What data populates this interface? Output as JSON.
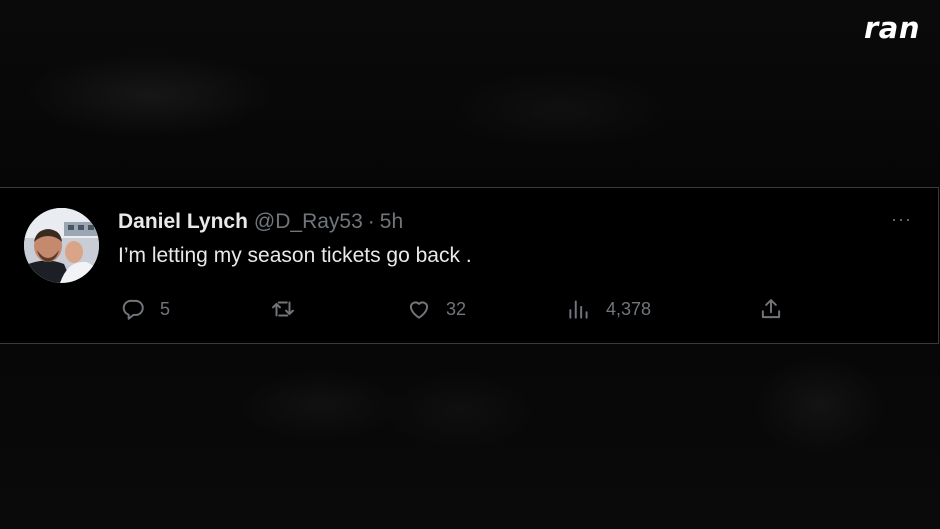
{
  "brand": {
    "logo_text": "ran"
  },
  "tweet": {
    "author_name": "Daniel Lynch",
    "handle": "@D_Ray53",
    "separator": "·",
    "time": "5h",
    "text": "I’m letting my season tickets go back .",
    "more_label": "···",
    "actions": {
      "reply_count": "5",
      "retweet_count": "",
      "like_count": "32",
      "views_count": "4,378"
    }
  },
  "icons": {
    "reply": "reply-icon",
    "retweet": "retweet-icon",
    "like": "heart-icon",
    "views": "views-icon",
    "share": "share-icon"
  },
  "colors": {
    "background": "#000000",
    "text_primary": "#e7e9ea",
    "text_secondary": "#71767b",
    "border": "#3a3a3a"
  }
}
